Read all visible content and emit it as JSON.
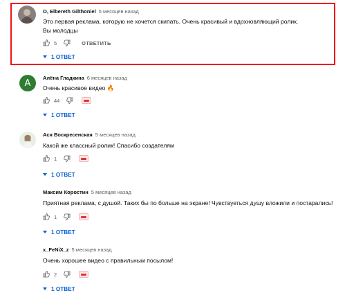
{
  "comments": [
    {
      "author": "O, Elbereth Gilthoniel",
      "time": "5 месяцев назад",
      "text_lines": [
        "Это первая реклама, которую не хочется скипать. Очень красивый и вдохновляющий ролик.",
        "Вы молодцы"
      ],
      "likes": "5",
      "reply_label": "ОТВЕТИТЬ",
      "replies_label": "1 ОТВЕТ",
      "avatar_icon": "photo-avatar-icon",
      "highlighted": true
    },
    {
      "author": "Алёна Гладкина",
      "time": "6 месяцев назад",
      "text_lines": [
        "Очень красивое видео 🔥"
      ],
      "likes": "44",
      "replies_label": "1 ОТВЕТ",
      "avatar_letter": "А",
      "avatar_color": "#2e7d32"
    },
    {
      "author": "Ася Воскресенская",
      "time": "5 месяцев назад",
      "text_lines": [
        "Какой же классный ролик! Спасибо создателям"
      ],
      "likes": "1",
      "replies_label": "1 ОТВЕТ",
      "avatar_icon": "photo-avatar-icon"
    },
    {
      "author": "Максим Коростин",
      "time": "5 месяцев назад",
      "text_lines": [
        "Приятная реклама, с душой. Таких бы по больше на экране! Чувствуеться душу вложили и постарались!"
      ],
      "likes": "1",
      "replies_label": "1 ОТВЕТ"
    },
    {
      "author": "x_FeNiX_z",
      "time": "5 месяцев назад",
      "text_lines": [
        "Очень хорошее видео с правильным посылом!"
      ],
      "likes": "2",
      "replies_label": "1 ОТВЕТ"
    }
  ],
  "colors": {
    "highlight_border": "#ee1111",
    "link_blue": "#065fd4",
    "muted": "#606060"
  }
}
